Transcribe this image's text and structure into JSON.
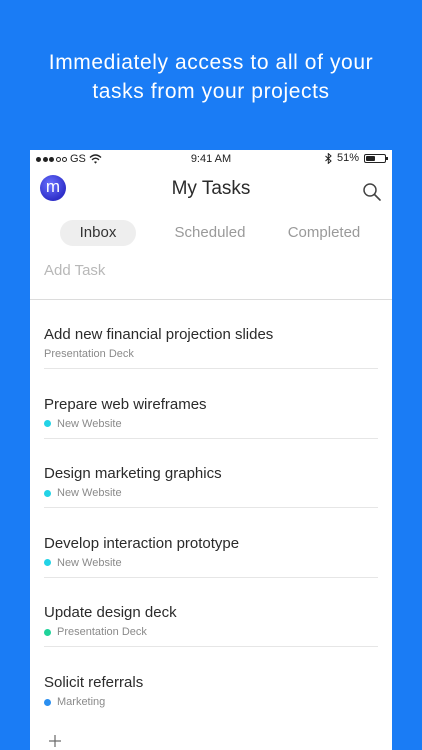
{
  "headline": {
    "line1": "Immediately access to all of your",
    "line2": "tasks from your projects"
  },
  "status_bar": {
    "carrier": "GS",
    "time": "9:41 AM",
    "battery": "51%",
    "battery_level": 0.51
  },
  "nav": {
    "avatar_letter": "m",
    "title": "My Tasks",
    "search_icon": "search-icon"
  },
  "tabs": [
    {
      "label": "Inbox",
      "active": true
    },
    {
      "label": "Scheduled",
      "active": false
    },
    {
      "label": "Completed",
      "active": false
    }
  ],
  "add_task": {
    "placeholder": "Add Task",
    "value": ""
  },
  "tasks": [
    {
      "title": "Add new financial projection slides",
      "project": "Presentation Deck",
      "color": ""
    },
    {
      "title": "Prepare web wireframes",
      "project": "New Website",
      "color": "#22d3e6"
    },
    {
      "title": "Design marketing graphics",
      "project": "New Website",
      "color": "#22d3e6"
    },
    {
      "title": "Develop interaction prototype",
      "project": "New Website",
      "color": "#22d3e6"
    },
    {
      "title": "Update design deck",
      "project": "Presentation Deck",
      "color": "#1fd39a"
    },
    {
      "title": "Solicit referrals",
      "project": "Marketing",
      "color": "#2a8ff0"
    }
  ],
  "colors": {
    "background": "#1a7cf5",
    "new_website": "#22d3e6",
    "presentation_deck": "#1fd39a",
    "marketing": "#2a8ff0"
  }
}
